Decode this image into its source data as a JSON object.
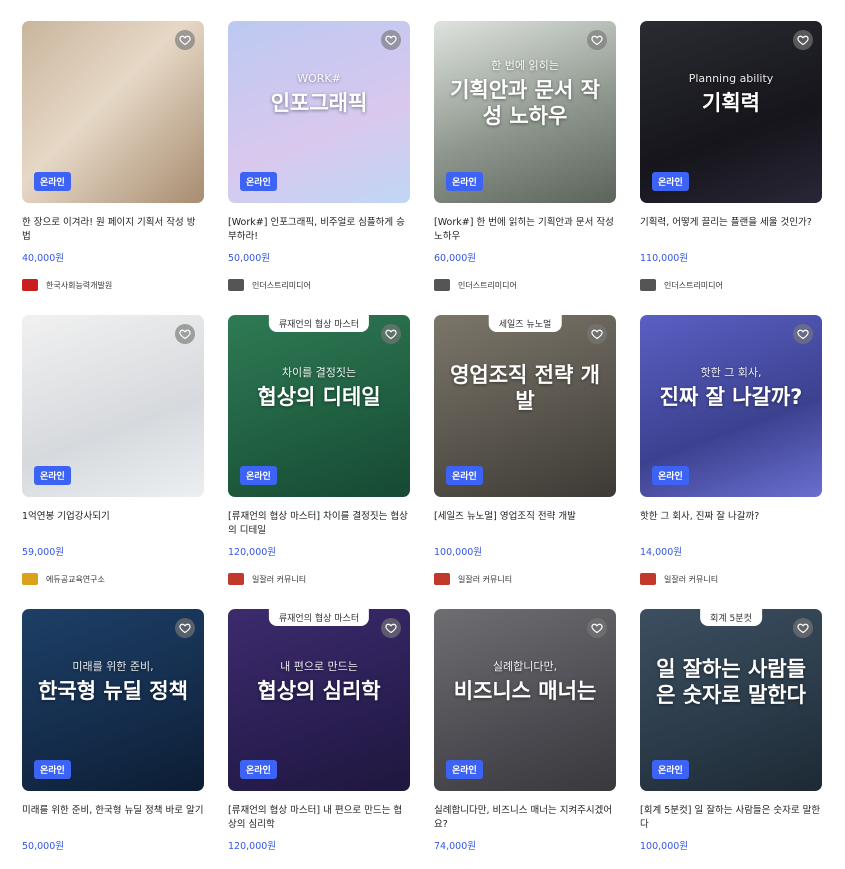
{
  "badge_label": "온라인",
  "colors": {
    "accent": "#3d63f5",
    "price": "#3457e0"
  },
  "rows": [
    [
      {
        "title": "한 장으로 이겨라! 원 페이지 기획서 작성 방법",
        "price": "40,000원",
        "org": "한국사회능력개발원",
        "bg": "linear-gradient(135deg,#c9b59d,#e6d8c6 45%,#a78c70)",
        "art_sub": "",
        "art_big": "",
        "tag": "",
        "logo": "#c81e1e"
      },
      {
        "title": "[Work#] 인포그래픽, 비주얼로 심플하게 승부하라!",
        "price": "50,000원",
        "org": "인더스트리미디어",
        "bg": "linear-gradient(160deg,#bcc9f2,#d9c8ee 60%,#c0d6f5)",
        "art_sub": "WORK#",
        "art_big": "인포그래픽",
        "tag": "",
        "logo": "#555555"
      },
      {
        "title": "[Work#] 한 번에 읽히는 기획안과 문서 작성 노하우",
        "price": "60,000원",
        "org": "인더스트리미디어",
        "bg": "linear-gradient(160deg,#dfe3df,#8e978e 55%,#5b635b)",
        "art_sub": "한 번에 읽히는",
        "art_big": "기획안과 문서 작성 노하우",
        "tag": "",
        "logo": "#555555"
      },
      {
        "title": "기획력, 어떻게 끌리는 플랜을 세울 것인가?",
        "price": "110,000원",
        "org": "인더스트리미디어",
        "bg": "linear-gradient(160deg,#2b2b33,#15151b 60%,#2a2637)",
        "art_sub": "Planning ability",
        "art_big": "기획력",
        "tag": "",
        "logo": "#555555"
      }
    ],
    [
      {
        "title": "1억연봉 기업강사되기",
        "price": "59,000원",
        "org": "에듀공교육연구소",
        "bg": "linear-gradient(160deg,#f1f1f1,#d6d9dd 60%,#eceff2)",
        "art_sub": "",
        "art_big": "",
        "tag": "",
        "logo": "#d9a21b"
      },
      {
        "title": "[류재언의 협상 마스터] 차이를 결정짓는 협상의 디테일",
        "price": "120,000원",
        "org": "일잘러 커뮤니티",
        "bg": "linear-gradient(160deg,#2f7a55,#1f5e40 60%,#174833)",
        "art_sub": "차이를 결정짓는",
        "art_big": "협상의 디테일",
        "tag": "류재언의 협상 마스터",
        "logo": "#c0392b"
      },
      {
        "title": "[세일즈 뉴노멀] 영업조직 전략 개발",
        "price": "100,000원",
        "org": "일잘러 커뮤니티",
        "bg": "linear-gradient(160deg,#7c7669,#5a564e 55%,#3d3a35)",
        "art_sub": "",
        "art_big": "영업조직 전략 개발",
        "tag": "세일즈 뉴노멀",
        "logo": "#c0392b"
      },
      {
        "title": "핫한 그 회사, 진짜 잘 나갈까?",
        "price": "14,000원",
        "org": "일잘러 커뮤니티",
        "bg": "linear-gradient(160deg,#5a5fc4,#3c418f 60%,#6a6fd0)",
        "art_sub": "핫한 그 회사,",
        "art_big": "진짜 잘 나갈까?",
        "tag": "",
        "logo": "#c0392b"
      }
    ],
    [
      {
        "title": "미래를 위한 준비, 한국형 뉴딜 정책 바로 알기",
        "price": "50,000원",
        "org": "",
        "bg": "linear-gradient(160deg,#1d3f66,#142c4b 60%,#0c1d33)",
        "art_sub": "미래를 위한 준비,",
        "art_big": "한국형 뉴딜 정책",
        "tag": "",
        "logo": "#ffffff"
      },
      {
        "title": "[류재언의 협상 마스터] 내 편으로 만드는 협상의 심리학",
        "price": "120,000원",
        "org": "",
        "bg": "linear-gradient(160deg,#3d2b6e,#2a1e52 60%,#1f173e)",
        "art_sub": "내 편으로 만드는",
        "art_big": "협상의 심리학",
        "tag": "류재언의 협상 마스터",
        "logo": "#ffffff"
      },
      {
        "title": "실례합니다만, 비즈니스 매너는 지켜주시겠어요?",
        "price": "74,000원",
        "org": "",
        "bg": "linear-gradient(160deg,#6e6e72,#4c4c52 60%,#38383d)",
        "art_sub": "실례합니다만,",
        "art_big": "비즈니스 매너는",
        "tag": "",
        "logo": "#ffffff"
      },
      {
        "title": "[회계 5분컷] 일 잘하는 사람들은 숫자로 말한다",
        "price": "100,000원",
        "org": "",
        "bg": "linear-gradient(160deg,#3c4f60,#2a3a48 60%,#1d2a35)",
        "art_sub": "",
        "art_big": "일 잘하는 사람들은 숫자로 말한다",
        "tag": "회계 5분컷",
        "logo": "#ffffff"
      }
    ]
  ]
}
